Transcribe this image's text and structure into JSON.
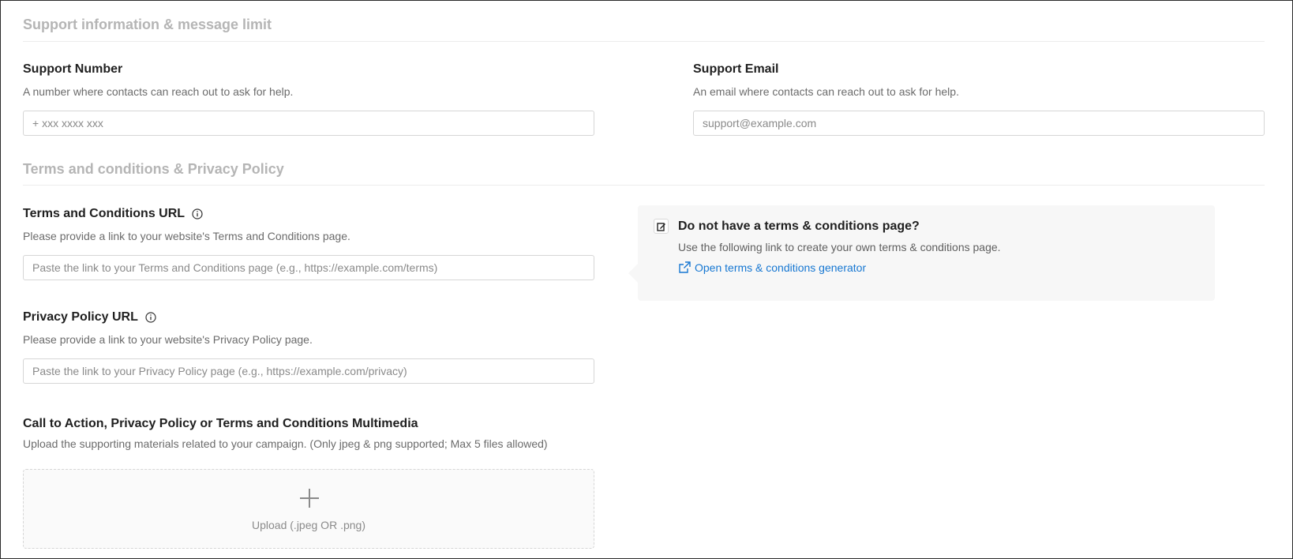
{
  "support_section": {
    "title": "Support information & message limit",
    "number": {
      "label": "Support Number",
      "help": "A number where contacts can reach out to ask for help.",
      "value": "",
      "placeholder": "+ xxx xxxx xxx"
    },
    "email": {
      "label": "Support Email",
      "help": "An email where contacts can reach out to ask for help.",
      "value": "",
      "placeholder": "support@example.com"
    }
  },
  "terms_section": {
    "title": "Terms and conditions & Privacy Policy",
    "terms": {
      "label": "Terms and Conditions URL",
      "help": "Please provide a link to your website's Terms and Conditions page.",
      "value": "",
      "placeholder": "Paste the link to your Terms and Conditions page (e.g., https://example.com/terms)",
      "icon": "info-icon"
    },
    "privacy": {
      "label": "Privacy Policy URL",
      "help": "Please provide a link to your website's Privacy Policy page.",
      "value": "",
      "placeholder": "Paste the link to your Privacy Policy page (e.g., https://example.com/privacy)",
      "icon": "info-icon"
    },
    "callout": {
      "title": "Do not have a terms & conditions page?",
      "text": "Use the following link to create your own terms & conditions page.",
      "link_label": "Open terms & conditions generator",
      "icon": "edit-icon",
      "link_icon": "external-link-icon"
    }
  },
  "multimedia": {
    "label": "Call to Action, Privacy Policy or Terms and Conditions Multimedia",
    "help": "Upload the supporting materials related to your campaign. (Only jpeg & png supported; Max 5 files allowed)",
    "upload_label": "Upload (.jpeg OR .png)",
    "icon": "plus-icon"
  },
  "colors": {
    "accent": "#1677d2",
    "section_title": "#b5b5b5",
    "callout_bg": "#f7f7f7"
  }
}
